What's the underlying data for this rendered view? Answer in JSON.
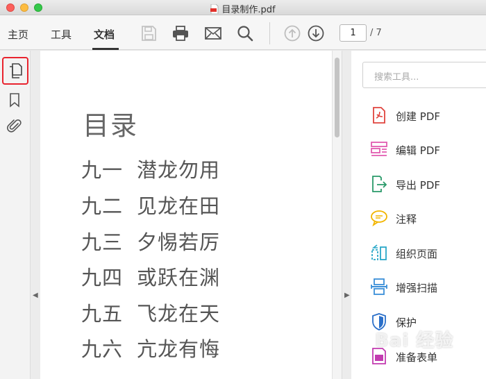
{
  "window": {
    "title": "目录制作.pdf"
  },
  "toolbar": {
    "tabs": [
      {
        "label": "主页"
      },
      {
        "label": "工具"
      },
      {
        "label": "文档"
      }
    ],
    "page_current": "1",
    "page_total": "/ 7"
  },
  "document": {
    "title": "目录",
    "lines": [
      {
        "num": "九一",
        "text": "潜龙勿用"
      },
      {
        "num": "九二",
        "text": "见龙在田"
      },
      {
        "num": "九三",
        "text": "夕惕若厉"
      },
      {
        "num": "九四",
        "text": "或跃在渊"
      },
      {
        "num": "九五",
        "text": "飞龙在天"
      },
      {
        "num": "九六",
        "text": "亢龙有悔"
      }
    ]
  },
  "tools_panel": {
    "search_placeholder": "搜索工具...",
    "items": [
      {
        "label": "创建 PDF",
        "icon": "create-pdf-icon",
        "color": "#e0443e"
      },
      {
        "label": "编辑 PDF",
        "icon": "edit-pdf-icon",
        "color": "#e25bb1"
      },
      {
        "label": "导出 PDF",
        "icon": "export-pdf-icon",
        "color": "#2a9a6a"
      },
      {
        "label": "注释",
        "icon": "comment-icon",
        "color": "#f2b500"
      },
      {
        "label": "组织页面",
        "icon": "organize-pages-icon",
        "color": "#2aa8c8"
      },
      {
        "label": "增强扫描",
        "icon": "enhance-scan-icon",
        "color": "#3b8fd8"
      },
      {
        "label": "保护",
        "icon": "protect-icon",
        "color": "#2a6fc9"
      },
      {
        "label": "准备表单",
        "icon": "prepare-form-icon",
        "color": "#c23bb0"
      }
    ]
  },
  "watermark": "Bai 经验",
  "colors": {
    "highlight": "#e8232e",
    "accent": "#333333"
  }
}
